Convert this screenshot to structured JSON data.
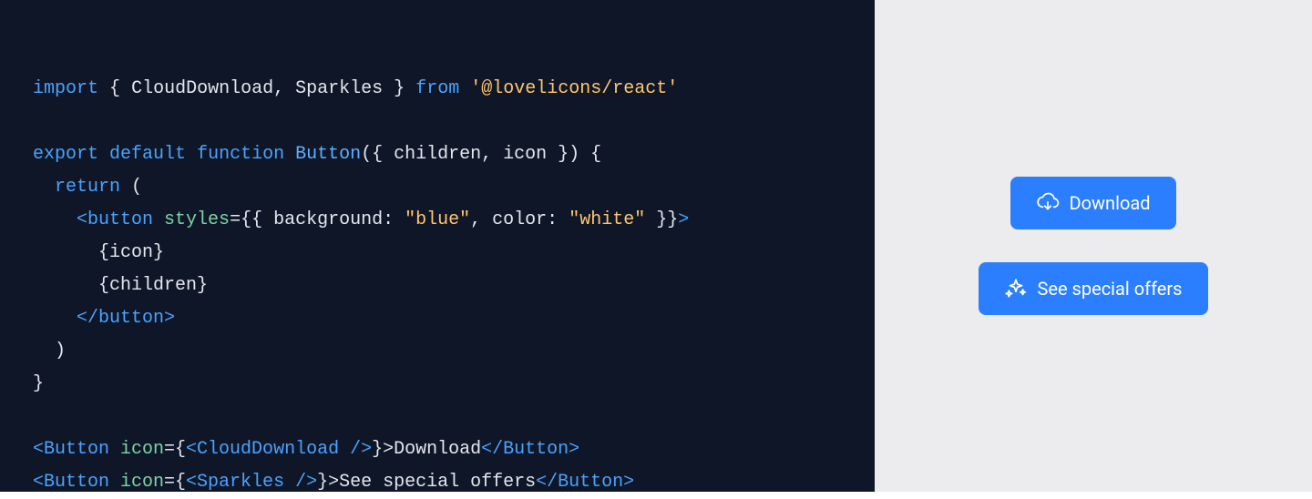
{
  "code": {
    "import_kw": "import",
    "lbrace": "{",
    "id_CloudDownload": "CloudDownload",
    "comma1": ",",
    "id_Sparkles": "Sparkles",
    "rbrace": "}",
    "from_kw": "from",
    "pkg": "'@lovelicons/react'",
    "export_kw": "export",
    "default_kw": "default",
    "function_kw": "function",
    "fn_name": "Button",
    "params": "({ children, icon }) {",
    "return_kw": "return",
    "return_paren": "(",
    "tag_button_open_lt": "<",
    "tag_button_name": "button ",
    "prop_styles": "styles",
    "jsx_expr_open": "={{ ",
    "bg_key": "background",
    "colon1": ": ",
    "bg_val": "\"blue\"",
    "comma2": ", ",
    "color_key": "color",
    "colon2": ": ",
    "color_val": "\"white\"",
    "jsx_expr_close": " }}",
    "gt": ">",
    "icon_expr": "{icon}",
    "children_expr": "{children}",
    "tag_button_close": "</button>",
    "close_paren": ")",
    "close_brace": "}",
    "usage1_btn_open": "<Button ",
    "usage1_icon_attr": "icon",
    "usage1_eq": "={",
    "usage1_comp": "<CloudDownload />",
    "usage1_close": "}>",
    "usage1_text": "Download",
    "usage1_btn_close": "</Button>",
    "usage2_btn_open": "<Button ",
    "usage2_icon_attr": "icon",
    "usage2_eq": "={",
    "usage2_comp": "<Sparkles />",
    "usage2_close": "}>",
    "usage2_text": "See special offers",
    "usage2_btn_close": "</Button>"
  },
  "preview": {
    "button1_label": "Download",
    "button2_label": "See special offers"
  }
}
